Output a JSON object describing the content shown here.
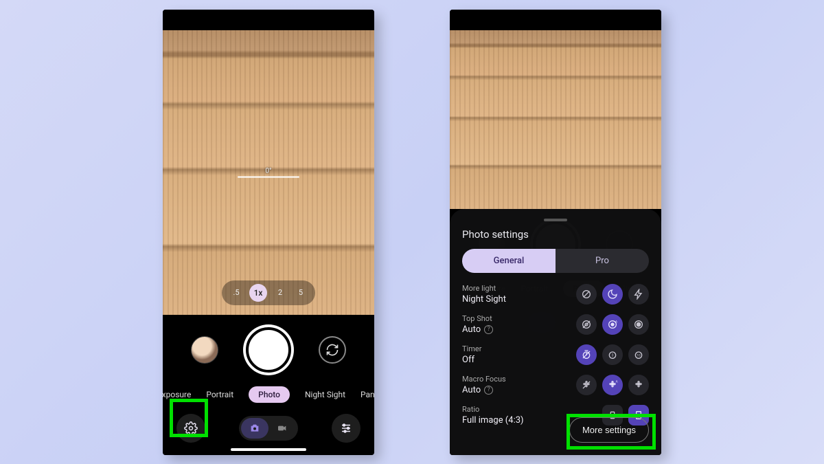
{
  "left": {
    "level_label": "0°",
    "zoom": [
      ".5",
      "1x",
      "2",
      "5"
    ],
    "zoom_active_index": 1,
    "modes": [
      "g Exposure",
      "Portrait",
      "Photo",
      "Night Sight",
      "Panora"
    ],
    "active_mode_index": 2
  },
  "right": {
    "panel_title": "Photo settings",
    "tabs": [
      "General",
      "Pro"
    ],
    "active_tab_index": 0,
    "settings": [
      {
        "label": "More light",
        "value": "Night Sight",
        "help": false,
        "icons": [
          "off",
          "moon",
          "flash"
        ],
        "selected": 1
      },
      {
        "label": "Top Shot",
        "value": "Auto",
        "help": true,
        "icons": [
          "no-rec",
          "auto-rec",
          "rec"
        ],
        "selected": 1
      },
      {
        "label": "Timer",
        "value": "Off",
        "help": false,
        "icons": [
          "timer-off",
          "timer-3",
          "timer-10"
        ],
        "selected": 0
      },
      {
        "label": "Macro Focus",
        "value": "Auto",
        "help": true,
        "icons": [
          "flower-off",
          "flower-auto",
          "flower"
        ],
        "selected": 1
      },
      {
        "label": "Ratio",
        "value": "Full image (4:3)",
        "help": false,
        "icons": [
          "ratio-full",
          "ratio-wide"
        ],
        "selected": 1
      }
    ],
    "more_settings_label": "More settings"
  }
}
